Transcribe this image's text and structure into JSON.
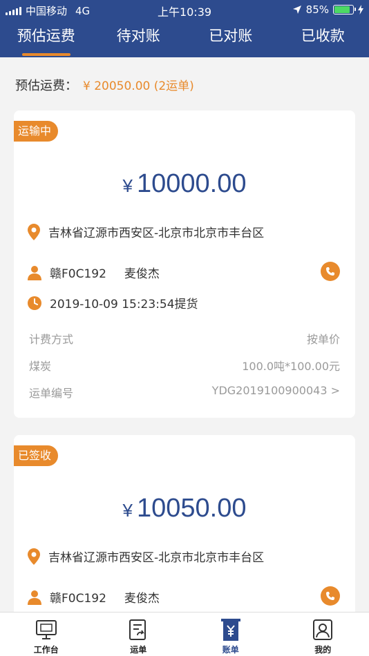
{
  "status_bar": {
    "carrier": "中国移动",
    "network": "4G",
    "time": "上午10:39",
    "battery": "85%"
  },
  "tabs": [
    {
      "label": "预估运费",
      "active": true
    },
    {
      "label": "待对账",
      "active": false
    },
    {
      "label": "已对账",
      "active": false
    },
    {
      "label": "已收款",
      "active": false
    }
  ],
  "summary": {
    "label": "预估运费：",
    "value": "¥ 20050.00 (2运单)"
  },
  "cards": [
    {
      "badge": "运输中",
      "currency": "¥",
      "amount": "10000.00",
      "route": "吉林省辽源市西安区-北京市北京市丰台区",
      "plate": "赣F0C192",
      "driver": "麦俊杰",
      "pickup": "2019-10-09 15:23:54提货",
      "billing_label": "计费方式",
      "billing_value": "按单价",
      "cargo_label": "煤炭",
      "cargo_value": "100.0吨*100.00元",
      "order_label": "运单编号",
      "order_value": "YDG2019100900043 >"
    },
    {
      "badge": "已签收",
      "currency": "¥",
      "amount": "10050.00",
      "route": "吉林省辽源市西安区-北京市北京市丰台区",
      "plate": "赣F0C192",
      "driver": "麦俊杰"
    }
  ],
  "tabbar": [
    {
      "label": "工作台",
      "icon": "monitor-icon",
      "active": false
    },
    {
      "label": "运单",
      "icon": "waybill-icon",
      "active": false
    },
    {
      "label": "账单",
      "icon": "bill-icon",
      "active": true
    },
    {
      "label": "我的",
      "icon": "profile-icon",
      "active": false
    }
  ],
  "colors": {
    "primary": "#2d4b8e",
    "accent": "#e88a2c",
    "background": "#f3f3f3"
  }
}
